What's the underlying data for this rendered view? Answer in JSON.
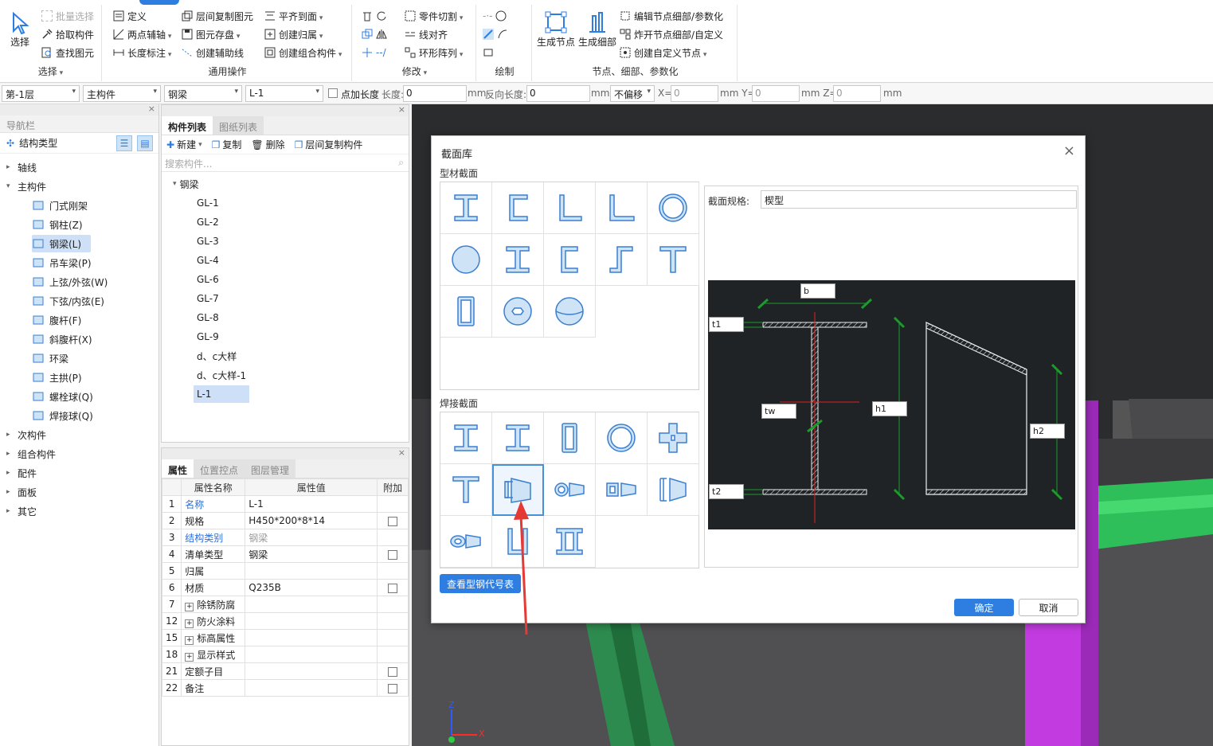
{
  "ribbon": {
    "groups": {
      "select": "选择",
      "common": "通用操作",
      "modify": "修改",
      "draw": "绘制",
      "nodes": "节点、细部、参数化"
    },
    "select_btn": "选择",
    "batch_select": "批量选择",
    "pick_component": "拾取构件",
    "find_element": "查找图元",
    "define": "定义",
    "two_point_axis": "两点辅轴",
    "length_mark": "长度标注",
    "floor_copy": "层间复制图元",
    "element_save": "图元存盘",
    "create_aux_line": "创建辅助线",
    "align_to_surface": "平齐到面",
    "create_belong": "创建归属",
    "create_group": "创建组合构件",
    "part_cut": "零件切割",
    "line_align": "线对齐",
    "ring_array": "环形阵列",
    "gen_node": "生成节点",
    "gen_detail": "生成细部",
    "edit_node_detail": "编辑节点细部/参数化",
    "explode_node": "炸开节点细部/自定义",
    "create_custom_node": "创建自定义节点"
  },
  "propbar": {
    "floor": "第-1层",
    "category": "主构件",
    "type": "钢梁",
    "component": "L-1",
    "point_length": "点加长度",
    "length_label": "长度:",
    "length_value": "0",
    "unit_mm": "mm",
    "reverse_label": "反向长度:",
    "reverse_value": "0",
    "offset": "不偏移",
    "x_label": "X=",
    "x_value": "0",
    "y_label": "mm Y=",
    "y_value": "0",
    "z_label": "mm Z=",
    "z_value": "0",
    "z_unit": "mm"
  },
  "nav": {
    "title": "导航栏",
    "struct_type": "结构类型",
    "items": [
      {
        "label": "轴线",
        "level": 0,
        "expanded": false
      },
      {
        "label": "主构件",
        "level": 0,
        "expanded": true
      },
      {
        "label": "门式刚架",
        "level": 1
      },
      {
        "label": "钢柱(Z)",
        "level": 1
      },
      {
        "label": "钢梁(L)",
        "level": 1,
        "selected": true
      },
      {
        "label": "吊车梁(P)",
        "level": 1
      },
      {
        "label": "上弦/外弦(W)",
        "level": 1
      },
      {
        "label": "下弦/内弦(E)",
        "level": 1
      },
      {
        "label": "腹杆(F)",
        "level": 1
      },
      {
        "label": "斜腹杆(X)",
        "level": 1
      },
      {
        "label": "环梁",
        "level": 1
      },
      {
        "label": "主拱(P)",
        "level": 1
      },
      {
        "label": "螺栓球(Q)",
        "level": 1
      },
      {
        "label": "焊接球(Q)",
        "level": 1
      },
      {
        "label": "次构件",
        "level": 0,
        "expanded": false
      },
      {
        "label": "组合构件",
        "level": 0,
        "expanded": false
      },
      {
        "label": "配件",
        "level": 0,
        "expanded": false
      },
      {
        "label": "面板",
        "level": 0,
        "expanded": false
      },
      {
        "label": "其它",
        "level": 0,
        "expanded": false
      }
    ]
  },
  "comp": {
    "tab_list": "构件列表",
    "tab_drawings": "图纸列表",
    "new": "新建",
    "copy": "复制",
    "delete": "删除",
    "floor_copy": "层间复制构件",
    "search_placeholder": "搜索构件...",
    "root": "钢梁",
    "items": [
      "GL-1",
      "GL-2",
      "GL-3",
      "GL-4",
      "GL-6",
      "GL-7",
      "GL-8",
      "GL-9",
      "d、c大样",
      "d、c大样-1",
      "L-1"
    ]
  },
  "props": {
    "tab_props": "属性",
    "tab_position": "位置控点",
    "tab_layers": "图层管理",
    "col_name": "属性名称",
    "col_value": "属性值",
    "col_extra": "附加",
    "rows": [
      {
        "num": "1",
        "name": "名称",
        "value": "L-1",
        "link": true,
        "check": false
      },
      {
        "num": "2",
        "name": "规格",
        "value": "H450*200*8*14",
        "check": true
      },
      {
        "num": "3",
        "name": "结构类别",
        "value": "钢梁",
        "link": true,
        "grey": true,
        "check": false
      },
      {
        "num": "4",
        "name": "清单类型",
        "value": "钢梁",
        "check": true
      },
      {
        "num": "5",
        "name": "归属",
        "value": "",
        "check": false
      },
      {
        "num": "6",
        "name": "材质",
        "value": "Q235B",
        "check": true
      },
      {
        "num": "7",
        "name": "除锈防腐",
        "value": "",
        "plus": true,
        "check": false
      },
      {
        "num": "12",
        "name": "防火涂料",
        "value": "",
        "plus": true,
        "check": false
      },
      {
        "num": "15",
        "name": "标高属性",
        "value": "",
        "plus": true,
        "check": false
      },
      {
        "num": "18",
        "name": "显示样式",
        "value": "",
        "plus": true,
        "check": false
      },
      {
        "num": "21",
        "name": "定额子目",
        "value": "",
        "check": true
      },
      {
        "num": "22",
        "name": "备注",
        "value": "",
        "check": true
      }
    ]
  },
  "dialog": {
    "title": "截面库",
    "profile_section": "型材截面",
    "welded_section": "焊接截面",
    "spec_label": "截面规格:",
    "spec_value": "楔型",
    "code_table_btn": "查看型钢代号表",
    "ok": "确定",
    "cancel": "取消",
    "dims": {
      "b": "b",
      "t1": "t1",
      "tw": "tw",
      "h1": "h1",
      "h2": "h2",
      "t2": "t2"
    }
  },
  "axes": {
    "x": "X",
    "z": "Z"
  },
  "colors": {
    "accent": "#2e7de1",
    "icon_fill": "#cfe3f7",
    "icon_stroke": "#3a7fd0",
    "arrow": "#e53935"
  }
}
